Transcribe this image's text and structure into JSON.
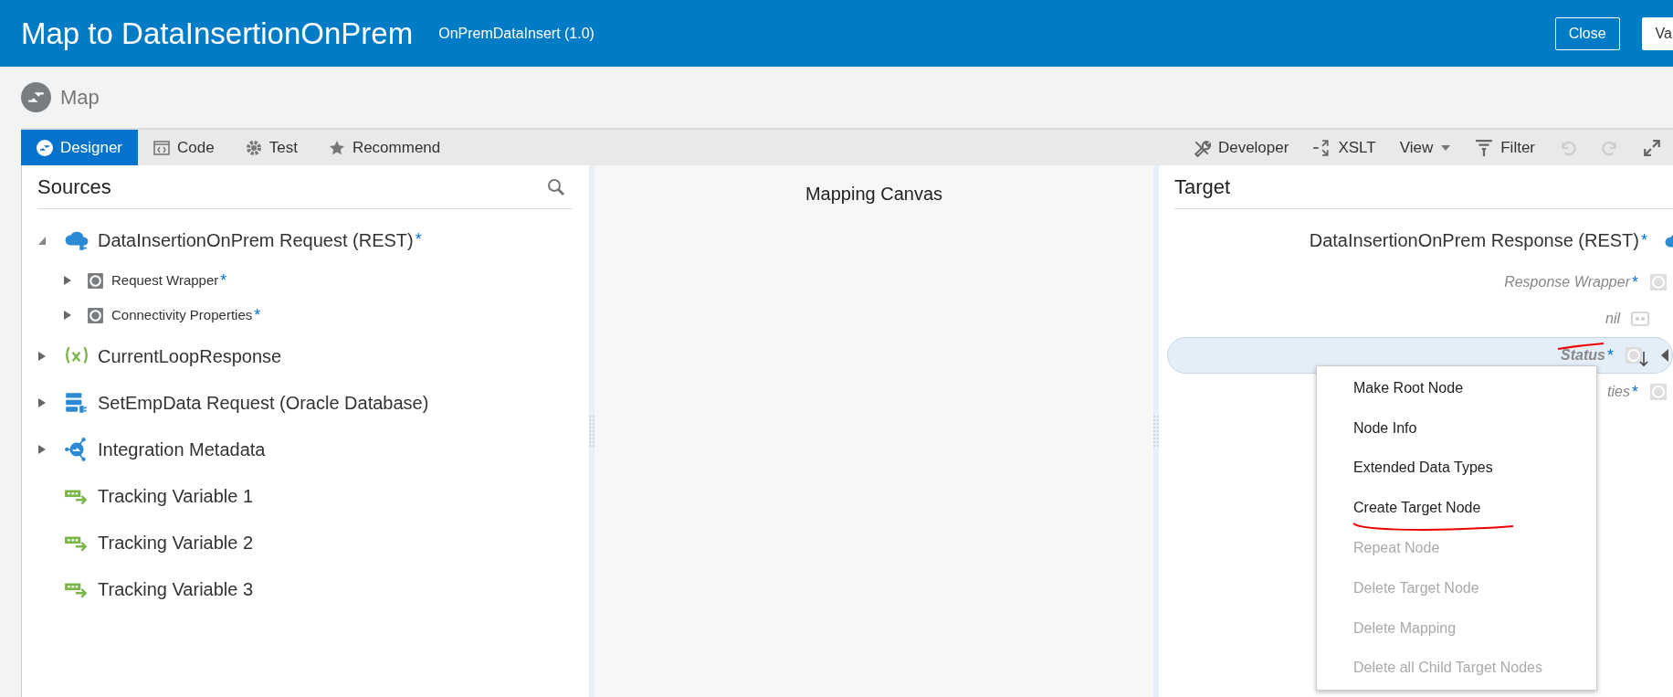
{
  "header": {
    "title": "Map to DataInsertionOnPrem",
    "subtitle": "OnPremDataInsert (1.0)",
    "buttons": [
      {
        "label": "Close",
        "kind": "outline"
      },
      {
        "label": "Va",
        "kind": "filled"
      }
    ]
  },
  "breadcrumb": {
    "label": "Map"
  },
  "tabs": [
    {
      "label": "Designer",
      "kind": "designer",
      "selected": true
    },
    {
      "label": "Code",
      "kind": "code",
      "selected": false
    },
    {
      "label": "Test",
      "kind": "test",
      "selected": false
    },
    {
      "label": "Recommend",
      "kind": "recommend",
      "selected": false
    }
  ],
  "tools": [
    {
      "label": "Developer",
      "kind": "developer",
      "disabled": false
    },
    {
      "label": "XSLT",
      "kind": "xslt",
      "disabled": false
    },
    {
      "label": "View",
      "kind": "view",
      "disabled": false
    },
    {
      "label": "Filter",
      "kind": "filter",
      "disabled": false
    },
    {
      "kind": "undo",
      "disabled": true
    },
    {
      "kind": "redo",
      "disabled": true
    },
    {
      "kind": "expand",
      "disabled": false
    }
  ],
  "sources": {
    "title": "Sources",
    "items": [
      {
        "label": "DataInsertionOnPrem Request (REST)",
        "kind": "rest",
        "marker": "*",
        "expanded": true,
        "children": [
          {
            "label": "Request Wrapper",
            "kind": "element",
            "marker": "*",
            "expanded": false
          },
          {
            "label": "Connectivity Properties",
            "kind": "element",
            "marker": "*",
            "expanded": false
          }
        ]
      },
      {
        "label": "CurrentLoopResponse",
        "kind": "variable",
        "expanded": false
      },
      {
        "label": "SetEmpData Request (Oracle Database)",
        "kind": "database",
        "expanded": false
      },
      {
        "label": "Integration Metadata",
        "kind": "metadata",
        "expanded": false
      },
      {
        "label": "Tracking Variable 1",
        "kind": "tracking"
      },
      {
        "label": "Tracking Variable 2",
        "kind": "tracking"
      },
      {
        "label": "Tracking Variable 3",
        "kind": "tracking"
      }
    ]
  },
  "canvas": {
    "title": "Mapping Canvas"
  },
  "target": {
    "title": "Target",
    "rows": [
      {
        "label": "DataInsertionOnPrem Response (REST)",
        "kind": "root",
        "marker": "*",
        "selected": false
      },
      {
        "label": "Response Wrapper",
        "kind": "element",
        "marker": "*",
        "selected": false
      },
      {
        "label": "nil",
        "kind": "attribute",
        "selected": false
      },
      {
        "label": "Status",
        "kind": "element",
        "marker": "*",
        "selected": true
      },
      {
        "label": "ties",
        "kind": "element",
        "marker": "*",
        "selected": false
      }
    ]
  },
  "context_menu": {
    "items": [
      {
        "label": "Make Root Node",
        "disabled": false
      },
      {
        "label": "Node Info",
        "disabled": false
      },
      {
        "label": "Extended Data Types",
        "disabled": false
      },
      {
        "label": "Create Target Node",
        "disabled": false
      },
      {
        "label": "Repeat Node",
        "disabled": true
      },
      {
        "label": "Delete Target Node",
        "disabled": true
      },
      {
        "label": "Delete Mapping",
        "disabled": true
      },
      {
        "label": "Delete all Child Target Nodes",
        "disabled": true
      }
    ]
  }
}
